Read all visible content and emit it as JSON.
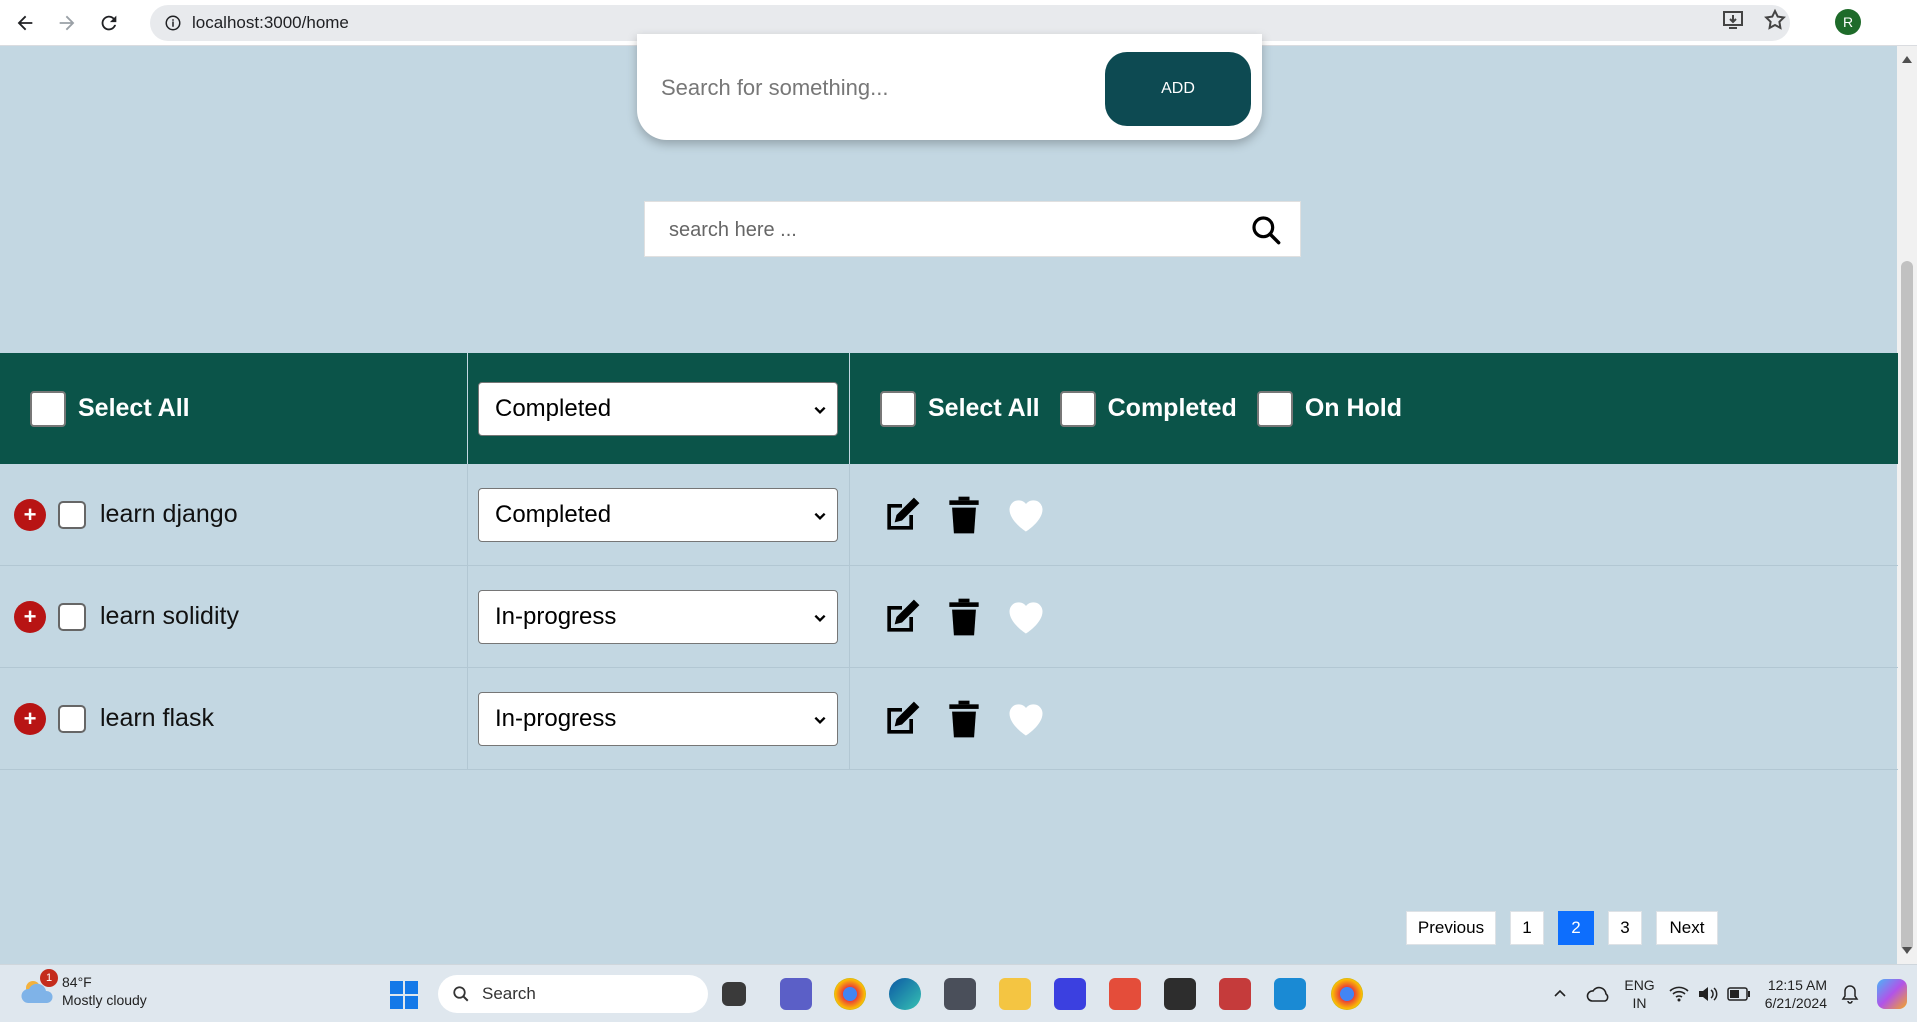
{
  "browser": {
    "url": "localhost:3000/home",
    "profile_initial": "R"
  },
  "add_form": {
    "placeholder": "Search for something...",
    "button_label": "ADD"
  },
  "search": {
    "placeholder": "search here ..."
  },
  "table_header": {
    "select_all_label": "Select All",
    "status_filter": "Completed",
    "bulk": {
      "select_all_label": "Select All",
      "completed_label": "Completed",
      "on_hold_label": "On Hold"
    }
  },
  "tasks": [
    {
      "name": "learn django",
      "status": "Completed"
    },
    {
      "name": "learn solidity",
      "status": "In-progress"
    },
    {
      "name": "learn flask",
      "status": "In-progress"
    }
  ],
  "pagination": {
    "previous": "Previous",
    "pages": [
      "1",
      "2",
      "3"
    ],
    "active_page": "2",
    "next": "Next"
  },
  "taskbar": {
    "weather_temp": "84°F",
    "weather_desc": "Mostly cloudy",
    "weather_badge": "1",
    "search_label": "Search",
    "lang_1": "ENG",
    "lang_2": "IN",
    "time": "12:15 AM",
    "date": "6/21/2024"
  },
  "colors": {
    "page_bg": "#c3d7e2",
    "header_bg": "#0b5449",
    "add_button": "#0d4a52",
    "plus_icon": "#b81414",
    "active_page": "#0d6efd"
  }
}
